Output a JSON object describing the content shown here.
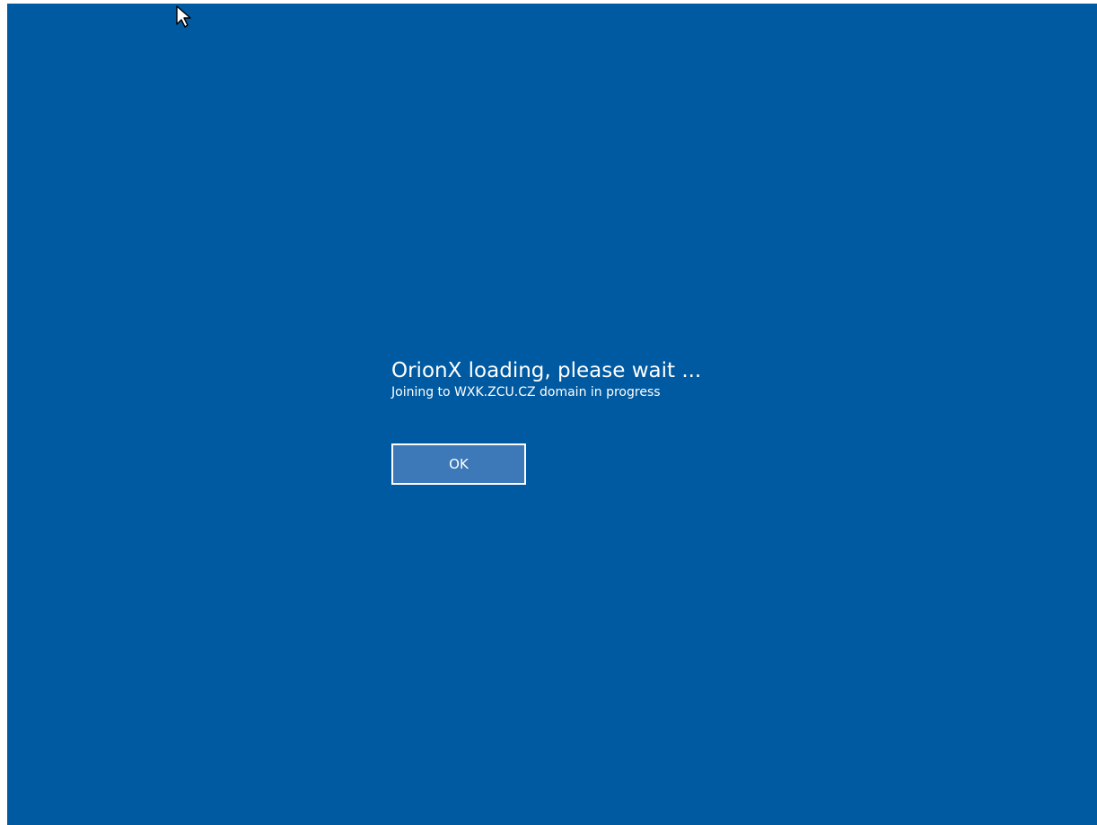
{
  "screen": {
    "background_color": "#005aa1",
    "title": "OrionX loading, please wait ...",
    "subtitle": "Joining to WXK.ZCU.CZ domain in progress",
    "ok_button_label": "OK"
  },
  "cursor": {
    "icon": "arrow-cursor-icon"
  }
}
